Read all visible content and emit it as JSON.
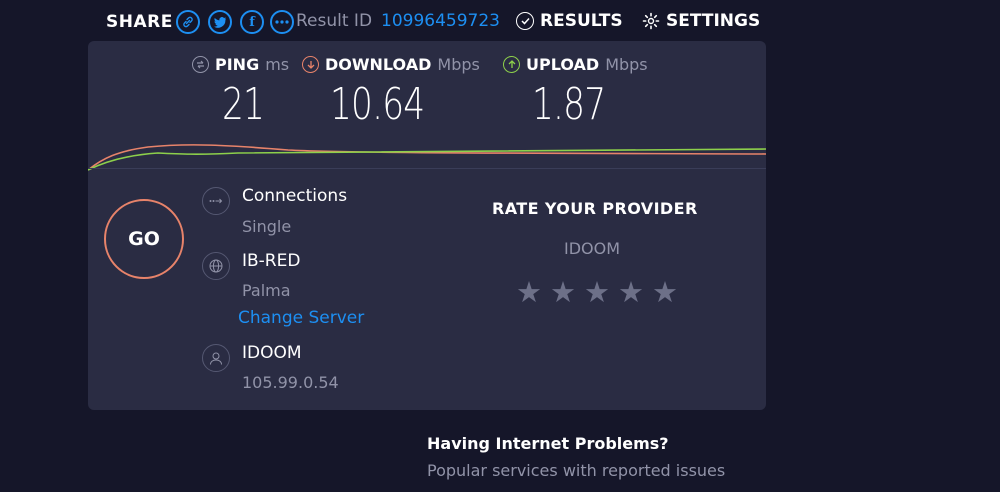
{
  "share": {
    "label": "SHARE"
  },
  "result": {
    "label": "Result ID",
    "id": "10996459723"
  },
  "nav": {
    "results": "RESULTS",
    "settings": "SETTINGS"
  },
  "metrics": {
    "ping": {
      "label": "PING",
      "unit": "ms",
      "value": "21"
    },
    "download": {
      "label": "DOWNLOAD",
      "unit": "Mbps",
      "value": "10.64"
    },
    "upload": {
      "label": "UPLOAD",
      "unit": "Mbps",
      "value": "1.87"
    }
  },
  "go": {
    "label": "GO"
  },
  "connections": {
    "title": "Connections",
    "value": "Single"
  },
  "server": {
    "name": "IB-RED",
    "location": "Palma",
    "change_label": "Change Server"
  },
  "isp": {
    "name": "IDOOM",
    "ip": "105.99.0.54"
  },
  "rate": {
    "title": "RATE YOUR PROVIDER",
    "provider": "IDOOM",
    "stars": [
      "★",
      "★",
      "★",
      "★",
      "★"
    ]
  },
  "problems": {
    "title": "Having Internet Problems?",
    "subtitle": "Popular services with reported issues"
  },
  "colors": {
    "accent": "#1d8ff2",
    "download": "#e7836a",
    "upload": "#8dd04b",
    "background": "#151629",
    "card": "#2a2c43"
  }
}
